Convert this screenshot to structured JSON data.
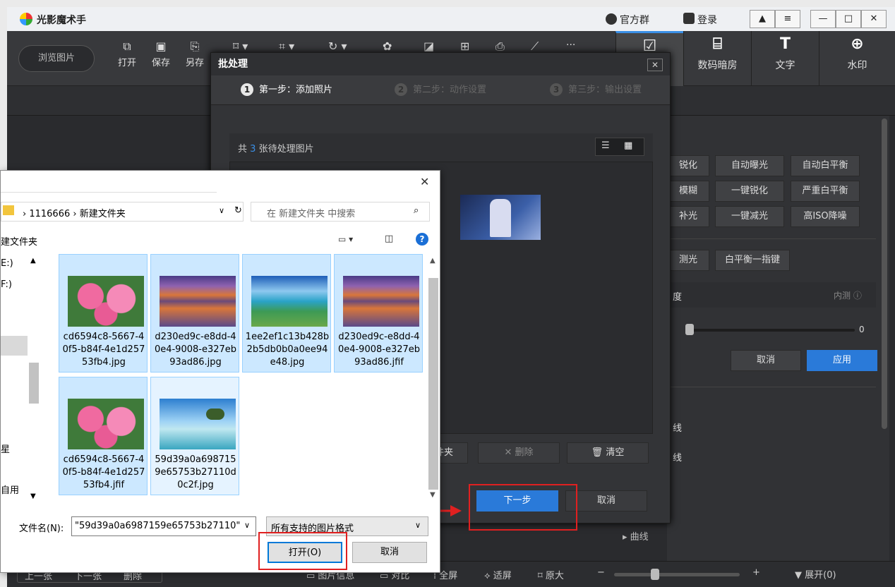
{
  "app": {
    "name": "光影魔术手",
    "title_right": {
      "group": "官方群",
      "login": "登录"
    },
    "window_buttons": [
      "▲",
      "≡",
      "—",
      "□",
      "✕"
    ]
  },
  "toolbar": {
    "browse": "浏览图片",
    "open": "打开",
    "save": "保存",
    "saveas": "另存",
    "more": "···",
    "right_tabs": [
      "数码暗房",
      "文字",
      "水印"
    ]
  },
  "right_panel": {
    "buttons_row1": [
      "锐化",
      "自动曝光",
      "自动白平衡"
    ],
    "buttons_row2": [
      "模糊",
      "一键锐化",
      "严重白平衡"
    ],
    "buttons_row3": [
      "补光",
      "一键减光",
      "高ISO降噪"
    ],
    "buttons_row4": [
      "测光",
      "白平衡一指键"
    ],
    "section": "度",
    "inner": "内测 ⓘ",
    "slider_value": "0",
    "cancel": "取消",
    "apply": "应用",
    "item1": "线",
    "item2": "线"
  },
  "bottom": {
    "prev": "上一张",
    "next": "下一张",
    "del": "删除",
    "info": "图片信息",
    "compare": "对比",
    "full": "全屏",
    "fit": "适屏",
    "orig": "原大",
    "minus": "−",
    "plus": "+",
    "expand": "▼ 展开(0)",
    "curve": "▸ 曲线"
  },
  "batch": {
    "title": "批处理",
    "step1": "第一步：添加照片",
    "step2": "第二步：动作设置",
    "step3": "第三步：输出设置",
    "count_prefix": "共",
    "count": "3",
    "count_suffix": "张待处理图片",
    "add_folder": "件夹",
    "delete": "✕ 删除",
    "clear": "清空",
    "next": "下一步",
    "cancel": "取消"
  },
  "file_dialog": {
    "breadcrumb": [
      "1116666",
      "新建文件夹"
    ],
    "search_placeholder": "在 新建文件夹 中搜索",
    "left_label": "建文件夹",
    "left_items": [
      "E:)",
      "F:)",
      "星",
      "自用"
    ],
    "files": [
      {
        "name": "cd6594c8-5667-40f5-b84f-4e1d25753fb4.jpg",
        "thumb": "flowers"
      },
      {
        "name": "d230ed9c-e8dd-40e4-9008-e327eb93ad86.jpg",
        "thumb": "mountain"
      },
      {
        "name": "1ee2ef1c13b428b2b5db0b0a0ee94e48.jpg",
        "thumb": "lake"
      },
      {
        "name": "d230ed9c-e8dd-40e4-9008-e327eb93ad86.jfif",
        "thumb": "mountain"
      },
      {
        "name": "cd6594c8-5667-40f5-b84f-4e1d25753fb4.jfif",
        "thumb": "flowers"
      },
      {
        "name": "59d39a0a6987159e65753b27110d0c2f.jpg",
        "thumb": "tree"
      }
    ],
    "filename_label": "文件名(N):",
    "filename_value": "\"59d39a0a6987159e65753b27110\"",
    "filetype": "所有支持的图片格式",
    "open": "打开(O)",
    "cancel": "取消"
  }
}
